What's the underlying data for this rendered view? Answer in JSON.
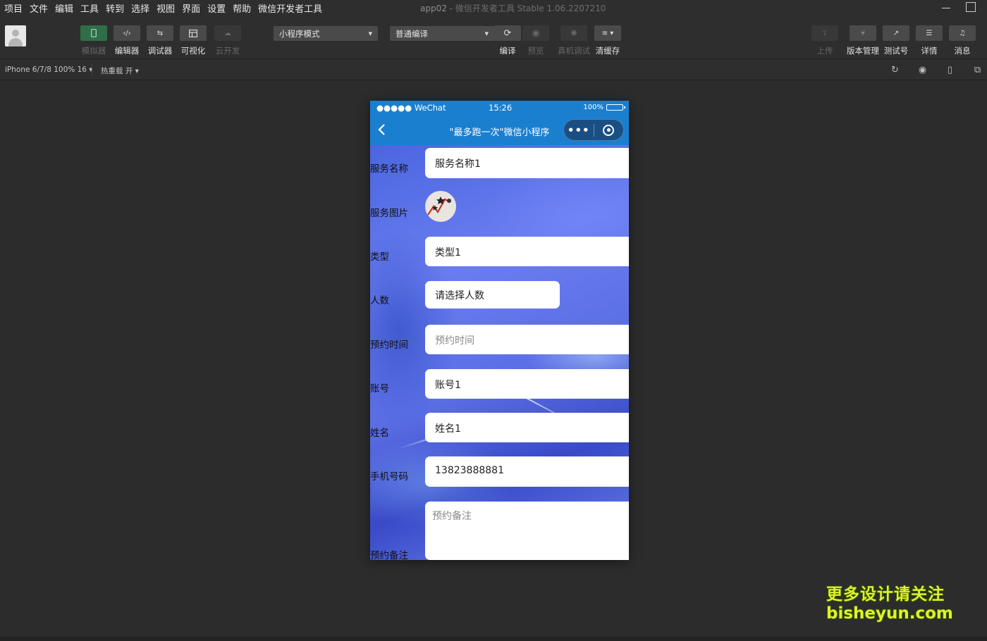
{
  "menu": [
    "项目",
    "文件",
    "编辑",
    "工具",
    "转到",
    "选择",
    "视图",
    "界面",
    "设置",
    "帮助",
    "微信开发者工具"
  ],
  "window": {
    "app": "app02",
    "separator": " - ",
    "product": "微信开发者工具 Stable 1.06.2207210"
  },
  "toolbar": {
    "left_buttons": [
      {
        "label": "模拟器",
        "icon": "phone-icon",
        "state": "active"
      },
      {
        "label": "编辑器",
        "icon": "code-icon",
        "state": "normal"
      },
      {
        "label": "调试器",
        "icon": "debug-icon",
        "state": "normal"
      },
      {
        "label": "可视化",
        "icon": "layout-icon",
        "state": "normal"
      },
      {
        "label": "云开发",
        "icon": "cloud-icon",
        "state": "disabled"
      }
    ],
    "mode_select": "小程序模式",
    "compile_select": "普通编译",
    "mid_buttons": [
      {
        "label": "编译",
        "icon": "refresh-icon",
        "state": "normal"
      },
      {
        "label": "预览",
        "icon": "eye-icon",
        "state": "disabled"
      },
      {
        "label": "真机调试",
        "icon": "bug-icon",
        "state": "disabled"
      },
      {
        "label": "清缓存",
        "icon": "layers-icon",
        "state": "normal"
      }
    ],
    "right_buttons": [
      {
        "label": "上传",
        "icon": "upload-icon",
        "state": "disabled"
      },
      {
        "label": "版本管理",
        "icon": "branch-icon",
        "state": "normal"
      },
      {
        "label": "测试号",
        "icon": "external-icon",
        "state": "normal"
      },
      {
        "label": "详情",
        "icon": "menu-icon",
        "state": "normal"
      },
      {
        "label": "消息",
        "icon": "bell-icon",
        "state": "normal"
      }
    ]
  },
  "subbar": {
    "device": "iPhone 6/7/8 100% 16 ▾",
    "hot_reload": "热重载 开 ▾"
  },
  "phone": {
    "status": {
      "carrier": "●●●●● WeChat",
      "time": "15:26",
      "battery": "100%"
    },
    "nav_title": "\"最多跑一次\"微信小程序",
    "capsule_dots": "•••",
    "rows": [
      {
        "label": "服务名称",
        "value": "服务名称1",
        "placeholder": false
      },
      {
        "label": "服务图片",
        "value": null
      },
      {
        "label": "类型",
        "value": "类型1",
        "placeholder": false
      },
      {
        "label": "人数",
        "value": "请选择人数",
        "placeholder": false
      },
      {
        "label": "预约时间",
        "value": "预约时间",
        "placeholder": true
      },
      {
        "label": "账号",
        "value": "账号1",
        "placeholder": false
      },
      {
        "label": "姓名",
        "value": "姓名1",
        "placeholder": false
      },
      {
        "label": "手机号码",
        "value": "13823888881",
        "placeholder": false
      },
      {
        "label": "预约备注",
        "value": "预约备注",
        "placeholder": true
      }
    ]
  },
  "watermark": {
    "line1": "更多设计请关注",
    "line2": "bisheyun.com"
  }
}
